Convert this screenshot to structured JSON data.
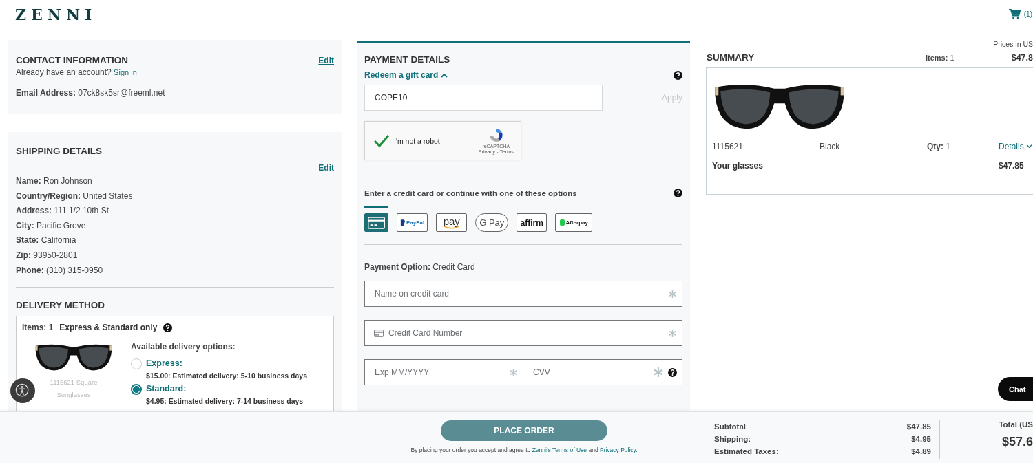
{
  "header": {
    "logo": "ZENNI",
    "cart_count": "(1)"
  },
  "contact": {
    "title": "CONTACT INFORMATION",
    "edit": "Edit",
    "prompt": "Already have an account?",
    "sign_in": "Sign in",
    "email": "**Email Address:** 07ck8sk5sr@freeml.net"
  },
  "shipping": {
    "title": "SHIPPING DETAILS",
    "edit": "Edit",
    "fields": [
      "**Name:** Ron Johnson",
      "**Country/Region:** United States",
      "**Address:** 111 1/2 10th St",
      "**City:** Pacific Grove",
      "**State:** California",
      "**Zip:** 93950-2801",
      "**Phone:** (310) 315-0950"
    ]
  },
  "delivery": {
    "title": "DELIVERY METHOD",
    "items": "**Items:** 1",
    "note": "Express & Standard only",
    "product_caption": "1115621 Square Sunglasses",
    "options_title": "Available delivery options:",
    "options": [
      {
        "name": "Express:",
        "detail": "$15.00: Estimated delivery: 5-10 business days",
        "selected": false
      },
      {
        "name": "Standard:",
        "detail": "$4.95: Estimated delivery: 7-14 business days",
        "selected": true
      }
    ]
  },
  "payment": {
    "title": "PAYMENT DETAILS",
    "gift_card_toggle": "Redeem a gift card",
    "expanded": true,
    "gift_card_value": "COPE10",
    "apply": "Apply",
    "captcha": {
      "label": "I'm not a robot",
      "checked": true,
      "brand": "reCAPTCHA",
      "links": "Privacy - Terms"
    },
    "options_prompt": "Enter a credit card or continue with one of these options",
    "methods": [
      {
        "kind": "card",
        "selected": true
      },
      {
        "kind": "paypal",
        "label": "PayPal",
        "selected": false
      },
      {
        "kind": "amazon",
        "label": "pay",
        "selected": false
      },
      {
        "kind": "gpay",
        "label": "G Pay",
        "selected": false
      },
      {
        "kind": "affirm",
        "label": "affirm",
        "selected": false
      },
      {
        "kind": "afterpay",
        "label": "Afterpay",
        "selected": false
      }
    ],
    "option": "**Payment Option:** Credit Card",
    "fields": [
      {
        "kind": "full",
        "placeholder": "Name on credit card"
      },
      {
        "kind": "card",
        "placeholder": "Credit Card Number"
      },
      {
        "kind": "half",
        "placeholder": "Exp MM/YYYY"
      },
      {
        "kind": "help",
        "placeholder": "CVV"
      }
    ]
  },
  "summary": {
    "prices_note": "Prices in US",
    "title": "SUMMARY",
    "items": "**Items:** 1",
    "total": "$47.8",
    "product": {
      "sku": "1115621",
      "color_name": "Black",
      "qty": "**Qty:** 1",
      "details": "Details",
      "name": "Your glasses",
      "price": "$47.85"
    }
  },
  "footer": {
    "place_order": "PLACE ORDER",
    "terms": "By placing your order you accept and agree to",
    "terms_link": "Zenni's Terms of Use",
    "and": "and",
    "privacy_link": "Privacy Policy.",
    "lines": [
      {
        "label": "Subtotal",
        "value": "$47.85"
      },
      {
        "label": "Shipping:",
        "value": "$4.95"
      },
      {
        "label": "Estimated Taxes:",
        "value": "$4.89"
      }
    ],
    "total_label": "Total (US",
    "total_value": "$57.6"
  },
  "chat": "Chat"
}
